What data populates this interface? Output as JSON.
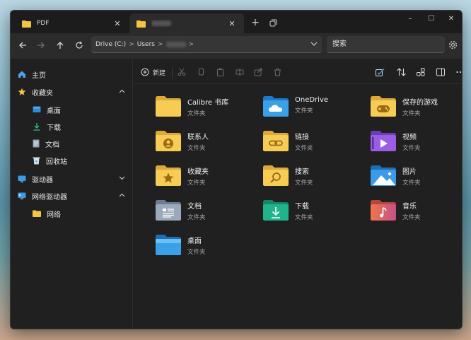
{
  "tabs": [
    {
      "label": "PDF",
      "close": "✕"
    },
    {
      "close": "✕"
    }
  ],
  "tab_new_label": "+",
  "window_controls": {
    "minimize": "–",
    "maximize": "☐",
    "close": "✕"
  },
  "address": {
    "drive": "Drive (C:)",
    "users": "Users",
    "sep": ">"
  },
  "search": {
    "placeholder": "搜索"
  },
  "sidebar": {
    "home": "主页",
    "favorites": "收藏夹",
    "desktop": "桌面",
    "downloads": "下载",
    "documents": "文档",
    "recycle": "回收站",
    "drives": "驱动器",
    "network_drives": "网络驱动器",
    "network": "网络"
  },
  "toolbar": {
    "new_label": "新建"
  },
  "items": [
    {
      "name": "Calibre 书库",
      "type": "文件夹",
      "icon": "folder-icon"
    },
    {
      "name": "OneDrive",
      "type": "文件夹",
      "icon": "onedrive-folder-icon"
    },
    {
      "name": "保存的游戏",
      "type": "文件夹",
      "icon": "games-folder-icon"
    },
    {
      "name": "联系人",
      "type": "文件夹",
      "icon": "contacts-folder-icon"
    },
    {
      "name": "链接",
      "type": "文件夹",
      "icon": "links-folder-icon"
    },
    {
      "name": "视频",
      "type": "文件夹",
      "icon": "videos-folder-icon"
    },
    {
      "name": "收藏夹",
      "type": "文件夹",
      "icon": "favorites-folder-icon"
    },
    {
      "name": "搜索",
      "type": "文件夹",
      "icon": "search-folder-icon"
    },
    {
      "name": "图片",
      "type": "文件夹",
      "icon": "pictures-folder-icon"
    },
    {
      "name": "文档",
      "type": "文件夹",
      "icon": "documents-folder-icon"
    },
    {
      "name": "下载",
      "type": "文件夹",
      "icon": "downloads-folder-icon"
    },
    {
      "name": "音乐",
      "type": "文件夹",
      "icon": "music-folder-icon"
    },
    {
      "name": "桌面",
      "type": "文件夹",
      "icon": "desktop-folder-icon"
    }
  ],
  "colors": {
    "window_bg": "#202020",
    "folder_yellow": "#f5c542",
    "accent_blue": "#3aa0e8"
  }
}
